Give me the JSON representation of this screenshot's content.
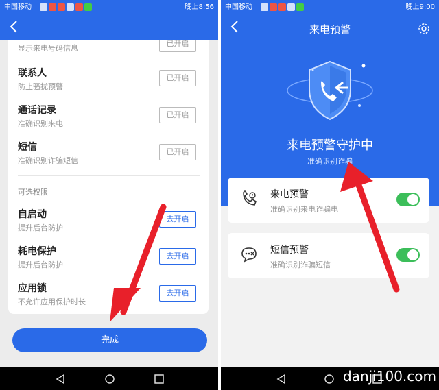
{
  "left": {
    "status": {
      "carrier": "中国移动",
      "time": "晚上8:56"
    },
    "permissions": [
      {
        "title": "",
        "desc": "显示来电号码信息",
        "button": "已开启",
        "state": "on"
      },
      {
        "title": "联系人",
        "desc": "防止骚扰预警",
        "button": "已开启",
        "state": "on"
      },
      {
        "title": "通话记录",
        "desc": "准确识别来电",
        "button": "已开启",
        "state": "on"
      },
      {
        "title": "短信",
        "desc": "准确识别诈骗短信",
        "button": "已开启",
        "state": "on"
      }
    ],
    "optional_label": "可选权限",
    "optional": [
      {
        "title": "自启动",
        "desc": "提升后台防护",
        "button": "去开启",
        "state": "off"
      },
      {
        "title": "耗电保护",
        "desc": "提升后台防护",
        "button": "去开启",
        "state": "off"
      },
      {
        "title": "应用锁",
        "desc": "不允许应用保护时长",
        "button": "去开启",
        "state": "off"
      }
    ],
    "done_label": "完成"
  },
  "right": {
    "status": {
      "carrier": "中国移动",
      "time": "晚上9:00"
    },
    "title": "来电预警",
    "guard_title": "来电预警守护中",
    "guard_sub": "准确识别诈骗",
    "cards": [
      {
        "title": "来电预警",
        "desc": "准确识别来电诈骗电",
        "icon": "phone-alert-icon",
        "enabled": true
      },
      {
        "title": "短信预警",
        "desc": "准确识别诈骗短信",
        "icon": "sms-alert-icon",
        "enabled": true
      }
    ]
  },
  "watermark": "danji100.com",
  "colors": {
    "primary": "#2a6ae8",
    "toggle": "#3cbe5a",
    "arrow": "#e8202a"
  }
}
